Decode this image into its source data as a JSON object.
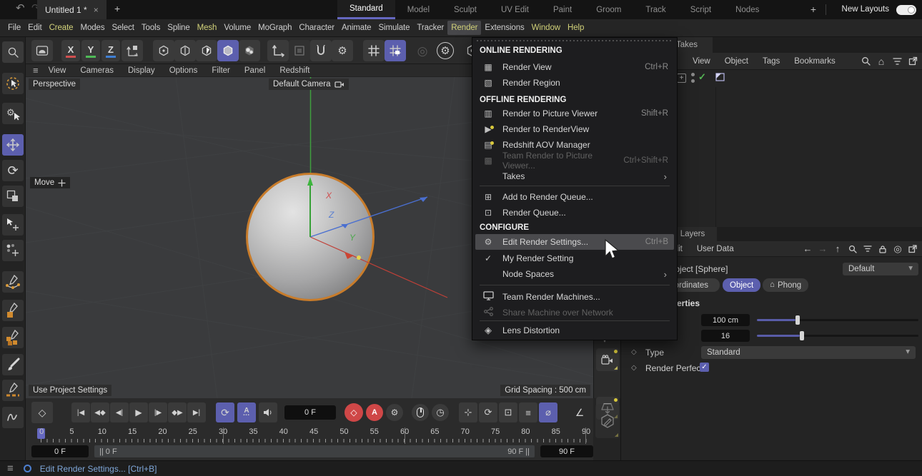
{
  "glyphs": {
    "undo": "↶",
    "redo": "↷",
    "close": "×",
    "plus": "+",
    "hamburger": "≡",
    "chevron_down": "▾",
    "submenu_arrow": "›",
    "check": "✓",
    "diamond": "◇",
    "gear": "⚙",
    "rotate": "⟳",
    "home": "⌂",
    "target": "◎",
    "back_arrow": "←",
    "forward_arrow": "→",
    "up_arrow": "↑",
    "lens": "◈",
    "rings": "◎",
    "autokey_a": "A",
    "tr_go_start": "|◀",
    "tr_prev_key": "◀◆",
    "tr_prev_frame": "◀|",
    "tr_play": "▶",
    "tr_next_frame": "|▶",
    "tr_next_key": "◆▶",
    "tr_go_end": "▶|",
    "loop": "⟳",
    "mi_render_view": "▦",
    "mi_render_region": "▧",
    "mi_picture_viewer": "▥",
    "mi_renderview": "▶",
    "mi_aov": "▤",
    "mi_team_pv": "▩",
    "mi_add_queue": "⊞",
    "mi_render_queue": "⊡",
    "mi_edit_settings": "⚙",
    "mi_machines": "▭",
    "mi_share": "<",
    "range_handle": "||",
    "pos_keys": "⊹",
    "rot_keys": "⟳",
    "scale_keys": "⊡",
    "param_keys": "≡",
    "nokey": "⌀",
    "dial": "◷",
    "graph": "∠"
  },
  "colors": {
    "accent": "#5c5fae",
    "selection_orange": "#c87c2b",
    "menu_yellow": "#d2d27a",
    "record_red": "#cf4747",
    "check_green": "#54b554",
    "status_blue": "#7fa7d9"
  },
  "title_bar": {
    "document_tab": "Untitled 1 *",
    "layout_tabs": [
      {
        "label": "Standard",
        "mod": "active"
      },
      {
        "label": "Model"
      },
      {
        "label": "Sculpt"
      },
      {
        "label": "UV Edit"
      },
      {
        "label": "Paint"
      },
      {
        "label": "Groom"
      },
      {
        "label": "Track"
      },
      {
        "label": "Script"
      },
      {
        "label": "Nodes"
      }
    ],
    "new_layouts_label": "New Layouts"
  },
  "menu_bar": {
    "items": [
      {
        "label": "File"
      },
      {
        "label": "Edit"
      },
      {
        "label": "Create",
        "mod": "yellow"
      },
      {
        "label": "Modes"
      },
      {
        "label": "Select"
      },
      {
        "label": "Tools"
      },
      {
        "label": "Spline"
      },
      {
        "label": "Mesh",
        "mod": "yellow"
      },
      {
        "label": "Volume"
      },
      {
        "label": "MoGraph"
      },
      {
        "label": "Character"
      },
      {
        "label": "Animate"
      },
      {
        "label": "Simulate"
      },
      {
        "label": "Tracker"
      },
      {
        "label": "Render",
        "mod": "yellow active"
      },
      {
        "label": "Extensions"
      },
      {
        "label": "Window",
        "mod": "yellow"
      },
      {
        "label": "Help",
        "mod": "yellow"
      }
    ]
  },
  "toolbar": {
    "x": "X",
    "y": "Y",
    "z": "Z"
  },
  "viewport": {
    "menu": [
      "View",
      "Cameras",
      "Display",
      "Options",
      "Filter",
      "Panel",
      "Redshift"
    ],
    "view_label": "Perspective",
    "camera_label": "Default Camera",
    "tool_hint": "Move",
    "project_settings_label": "Use Project Settings",
    "grid_spacing_label": "Grid Spacing : 500 cm",
    "axis_labels": {
      "x": "X",
      "y": "Y",
      "z": "Z"
    }
  },
  "render_menu": {
    "header_online": "ONLINE RENDERING",
    "header_offline": "OFFLINE RENDERING",
    "header_configure": "CONFIGURE",
    "items": {
      "render_view": {
        "label": "Render View",
        "shortcut": "Ctrl+R"
      },
      "render_region": {
        "label": "Render Region"
      },
      "render_to_picture_viewer": {
        "label": "Render to Picture Viewer",
        "shortcut": "Shift+R"
      },
      "render_to_renderview": {
        "label": "Render to RenderView"
      },
      "redshift_aov_manager": {
        "label": "Redshift AOV Manager"
      },
      "team_render_to_picture_viewer": {
        "label": "Team Render to Picture Viewer...",
        "shortcut": "Ctrl+Shift+R"
      },
      "takes": {
        "label": "Takes"
      },
      "add_to_render_queue": {
        "label": "Add to Render Queue..."
      },
      "render_queue": {
        "label": "Render Queue..."
      },
      "edit_render_settings": {
        "label": "Edit Render Settings...",
        "shortcut": "Ctrl+B"
      },
      "my_render_setting": {
        "label": "My Render Setting"
      },
      "node_spaces": {
        "label": "Node Spaces"
      },
      "team_render_machines": {
        "label": "Team Render Machines..."
      },
      "share_machine": {
        "label": "Share Machine over Network"
      },
      "lens_distortion": {
        "label": "Lens Distortion"
      }
    }
  },
  "object_manager": {
    "tab": "Takes",
    "menu": [
      "View",
      "Object",
      "Tags",
      "Bookmarks"
    ]
  },
  "attribute_manager": {
    "tab": "Layers",
    "menu": [
      "Edit",
      "User Data"
    ],
    "object_title": "Sphere Object [Sphere]",
    "layer_value": "Default",
    "tabs": [
      {
        "label": "Coordinates"
      },
      {
        "label": "Object"
      },
      {
        "label": "Phong"
      }
    ],
    "section_title": "Object Properties",
    "rows": {
      "radius": {
        "value": "100 cm"
      },
      "segments": {
        "value": "16"
      },
      "type": {
        "label": "Type",
        "value": "Standard"
      },
      "render_perfect": {
        "label": "Render Perfect",
        "checked": true
      }
    }
  },
  "timeline": {
    "current_frame": "0 F",
    "ruler": [
      "0",
      "5",
      "10",
      "15",
      "20",
      "25",
      "30",
      "35",
      "40",
      "45",
      "50",
      "55",
      "60",
      "65",
      "70",
      "75",
      "80",
      "85",
      "90"
    ],
    "range_start_field": "0 F",
    "range_bar_start": "0 F",
    "range_bar_end": "90 F",
    "range_end_field": "90 F"
  },
  "status_bar": {
    "message": "Edit Render Settings... [Ctrl+B]"
  }
}
